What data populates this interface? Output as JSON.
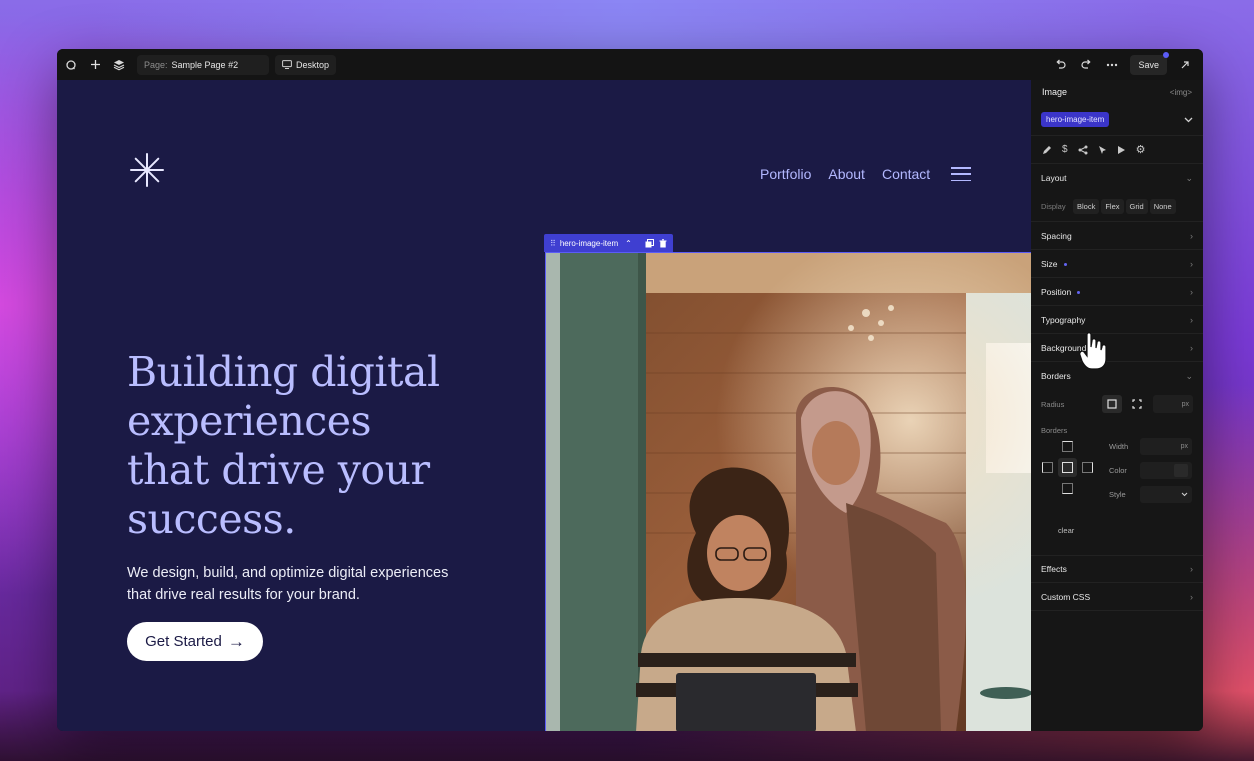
{
  "toolbar": {
    "page_label": "Page:",
    "page_name": "Sample Page #2",
    "device": "Desktop",
    "save_label": "Save"
  },
  "site": {
    "nav": [
      "Portfolio",
      "About",
      "Contact"
    ],
    "headline": [
      "Building digital",
      "experiences",
      "that drive your",
      "success."
    ],
    "subtext": [
      "We design, build, and optimize digital experiences",
      "that drive real results for your brand."
    ],
    "cta_label": "Get Started",
    "cta_arrow": "→",
    "selection_label": "hero-image-item"
  },
  "panel": {
    "title": "Image",
    "tag": "<img>",
    "class_chip": "hero-image-item",
    "sections": {
      "layout": "Layout",
      "display_label": "Display",
      "display_options": [
        "Block",
        "Flex",
        "Grid",
        "None"
      ],
      "spacing": "Spacing",
      "size": "Size",
      "position": "Position",
      "typography": "Typography",
      "background": "Background",
      "borders": "Borders",
      "radius_label": "Radius",
      "radius_unit": "px",
      "borders_label": "Borders",
      "width_label": "Width",
      "width_unit": "px",
      "color_label": "Color",
      "style_label": "Style",
      "clear_label": "clear",
      "effects": "Effects",
      "custom_css": "Custom CSS"
    }
  },
  "colors": {
    "canvas_bg": "#1b1a45",
    "headline": "#b9bdff",
    "accent": "#3f3fd1"
  }
}
